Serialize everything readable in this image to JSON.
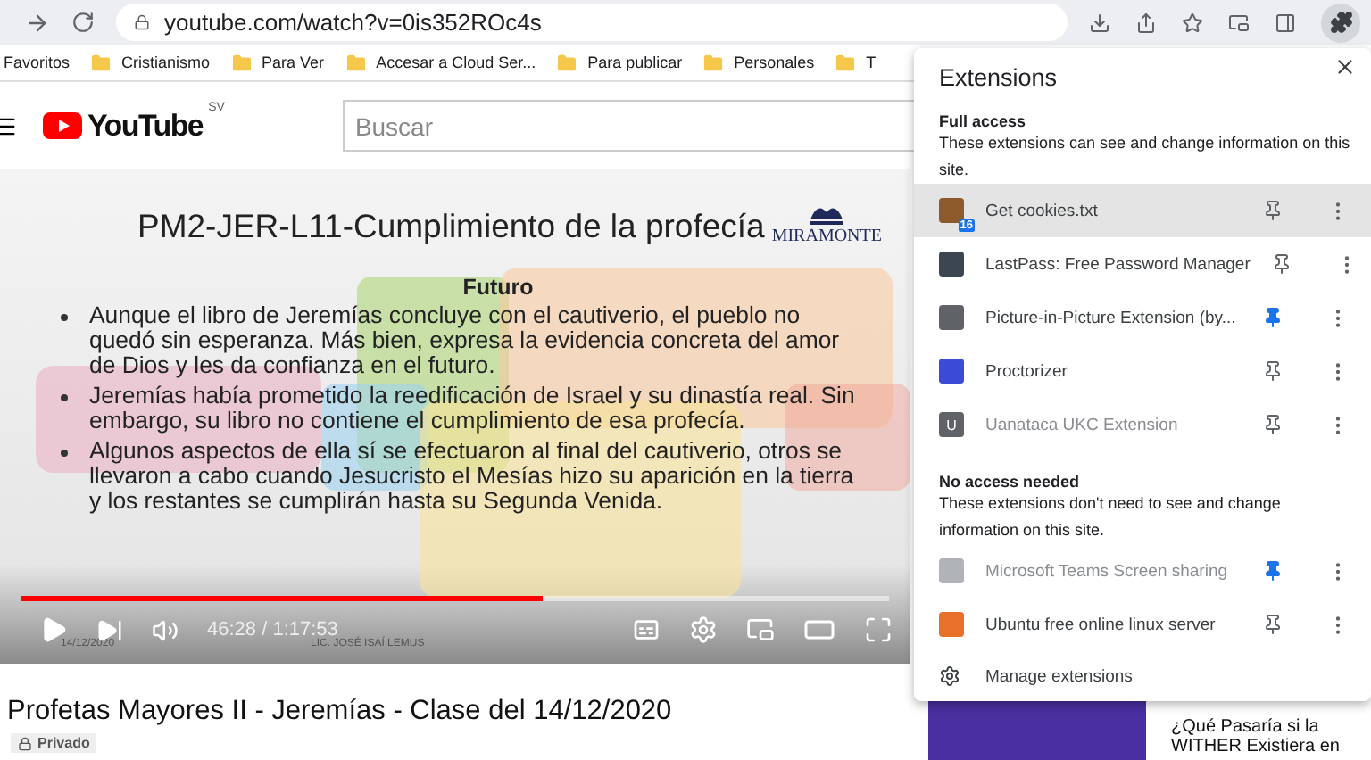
{
  "browser": {
    "url": "youtube.com/watch?v=0is352ROc4s",
    "bookmarks": [
      {
        "label": "Favoritos",
        "folder": false
      },
      {
        "label": "Cristianismo",
        "folder": true
      },
      {
        "label": "Para Ver",
        "folder": true
      },
      {
        "label": "Accesar a Cloud Ser...",
        "folder": true
      },
      {
        "label": "Para publicar",
        "folder": true
      },
      {
        "label": "Personales",
        "folder": true
      },
      {
        "label": "T",
        "folder": true
      }
    ]
  },
  "youtube": {
    "logo": "YouTube",
    "region": "SV",
    "search": {
      "placeholder": "Buscar"
    }
  },
  "video": {
    "slide": {
      "title": "PM2-JER-L11-Cumplimiento de la profecía",
      "logo": "MIRAMONTE",
      "heading": "Futuro",
      "bullets": [
        "Aunque el libro de Jeremías concluye con el cautiverio, el pueblo no quedó sin esperanza. Más bien, expresa la evidencia concreta del amor de Dios y les da confianza en el futuro.",
        "Jeremías había prometido la reedificación de Israel y su dinastía real. Sin embargo, su libro no contiene el cumplimiento de esa profecía.",
        "Algunos aspectos de ella sí se efectuaron al final del cautiverio, otros se llevaron a cabo cuando Jesucristo el Mesías hizo su aparición en la tierra y los restantes se cumplirán hasta su Segunda Venida."
      ],
      "date": "14/12/2020",
      "author": "LIC. JOSÉ ISAÍ LEMUS"
    },
    "progress": {
      "level": 0.6
    },
    "time": "46:28 / 1:17:53"
  },
  "title": "Profetas Mayores II - Jeremías - Clase del 14/12/2020",
  "visibility": "Privado",
  "recommendation": {
    "lines": [
      "¿Qué Pasaría si la",
      "WITHER Existiera en"
    ]
  },
  "extensions_popup": {
    "title": "Extensions",
    "sections": [
      {
        "heading": "Full access",
        "description": "These extensions can see and change information on this site.",
        "items": [
          {
            "name": "Get cookies.txt",
            "badge": "16",
            "pinned": false,
            "highlighted": true,
            "disabled": false,
            "color": "#8d5a2b"
          },
          {
            "name": "LastPass: Free Password Manager",
            "pinned": false,
            "highlighted": false,
            "disabled": false,
            "color": "#3c4650"
          },
          {
            "name": "Picture-in-Picture Extension (by...",
            "pinned": true,
            "highlighted": false,
            "disabled": false,
            "color": "#5f6368"
          },
          {
            "name": "Proctorizer",
            "pinned": false,
            "highlighted": false,
            "disabled": false,
            "color": "#3b4bd8"
          },
          {
            "name": "Uanataca UKC Extension",
            "icon_letter": "U",
            "pinned": false,
            "highlighted": false,
            "disabled": true,
            "color": "#5f6368"
          }
        ]
      },
      {
        "heading": "No access needed",
        "description": "These extensions don't need to see and change information on this site.",
        "items": [
          {
            "name": "Microsoft Teams Screen sharing",
            "pinned": true,
            "highlighted": false,
            "disabled": true,
            "color": "#b0b4b8"
          },
          {
            "name": "Ubuntu free online linux server",
            "pinned": false,
            "highlighted": false,
            "disabled": false,
            "color": "#e8702a"
          }
        ]
      }
    ],
    "manage": "Manage extensions"
  }
}
